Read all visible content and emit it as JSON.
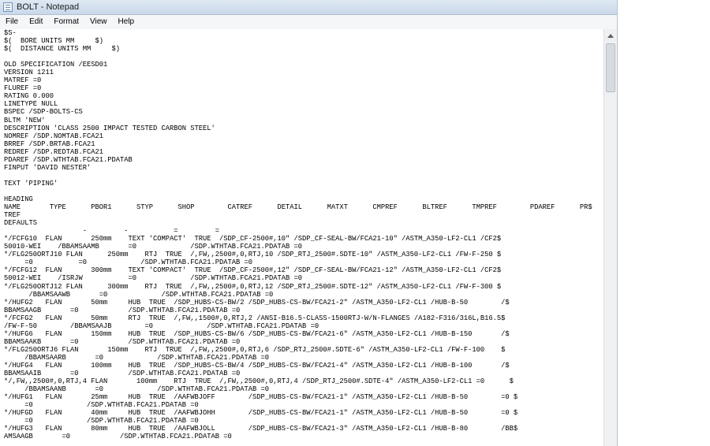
{
  "window": {
    "title": "BOLT - Notepad"
  },
  "menu": [
    "File",
    "Edit",
    "Format",
    "View",
    "Help"
  ],
  "document": {
    "lines": [
      "$S-",
      "$(  BORE UNITS MM     $)",
      "$(  DISTANCE UNITS MM     $)",
      "",
      "OLD SPECIFICATION /EESD01",
      "VERSION 1211",
      "MATREF =0",
      "FLUREF =0",
      "RATING 0.000",
      "LINETYPE NULL",
      "BSPEC /SDP-BOLTS-CS",
      "BLTM 'NEW'",
      "DESCRIPTION 'CLASS 2500 IMPACT TESTED CARBON STEEL'",
      "NOMREF /SDP.NOMTAB.FCA21",
      "BRREF /SDP.BRTAB.FCA21",
      "REDREF /SDP.REDTAB.FCA21",
      "PDAREF /SDP.WTHTAB.FCA21.PDATAB",
      "FINPUT 'DAVID NESTER'",
      "",
      "TEXT 'PIPING'",
      "",
      "HEADING",
      "NAME       TYPE      PBOR1      STYP      SHOP        CATREF      DETAIL      MATXT      CMPREF      BLTREF      TMPREF        PDAREF      PR$",
      "TREF",
      "DEFAULTS",
      "                   -         -           =         =",
      "*/FCFG10  FLAN       250mm    TEXT 'COMPACT'  TRUE  /SDP_CF-2500#,10\" /SDP_CF-SEAL-BW/FCA21-10\" /ASTM_A350-LF2-CL1 /CF2$",
      "50010-WEI    /BBAMSAAMB       =0             /SDP.WTHTAB.FCA21.PDATAB =0",
      "*/FLG250ORTJ10 FLAN      250mm    RTJ  TRUE  /,FW,,2500#,0,RTJ,10 /SDP_RTJ_2500#.SDTE-10\" /ASTM_A350-LF2-CL1 /FW-F-250 $",
      "     =0           =0             /SDP.WTHTAB.FCA21.PDATAB =0",
      "*/FCFG12  FLAN       300mm    TEXT 'COMPACT'  TRUE  /SDP_CF-2500#,12\" /SDP_CF-SEAL-BW/FCA21-12\" /ASTM_A350-LF2-CL1 /CF2$",
      "50012-WEI    /ISRJW           =0             /SDP.WTHTAB.FCA21.PDATAB =0",
      "*/FLG250ORTJ12 FLAN      300mm    RTJ  TRUE  /,FW,,2500#,0,RTJ,12 /SDP_RTJ_2500#.SDTE-12\" /ASTM_A350-LF2-CL1 /FW-F-300 $",
      "      /BBAMSAAWB       =0             /SDP.WTHTAB.FCA21.PDATAB =0",
      "*/HUFG2   FLAN       50mm     HUB  TRUE  /SDP_HUBS-CS-BW/2 /SDP_HUBS-CS-BW/FCA21-2\" /ASTM_A350-LF2-CL1 /HUB-B-50        /$",
      "BBAMSAAGB       =0            /SDP.WTHTAB.FCA21.PDATAB =0",
      "*/FCFG2   FLAN       50mm     RTJ  TRUE  /,FW,,1500#,0,RTJ,2 /ANSI-B16.5-CLASS-1500RTJ-W/N-FLANGES /A182-F316/316L,B16.5$",
      "/FW-F-50        /BBAMSAAJB        =0             /SDP.WTHTAB.FCA21.PDATAB =0",
      "*/HUFG6   FLAN       150mm    HUB  TRUE  /SDP_HUBS-CS-BW/6 /SDP_HUBS-CS-BW/FCA21-6\" /ASTM_A350-LF2-CL1 /HUB-B-150       /$",
      "BBAMSAAKB       =0            /SDP.WTHTAB.FCA21.PDATAB =0",
      "*/FLG250ORTJ6 FLAN       150mm    RTJ  TRUE  /,FW,,2500#,0,RTJ,6 /SDP_RTJ_2500#.SDTE-6\" /ASTM_A350-LF2-CL1 /FW-F-100    $",
      "     /BBAMSAARB       =0             /SDP.WTHTAB.FCA21.PDATAB =0",
      "*/HUFG4   FLAN       100mm    HUB  TRUE  /SDP_HUBS-CS-BW/4 /SDP_HUBS-CS-BW/FCA21-4\" /ASTM_A350-LF2-CL1 /HUB-B-100       /$",
      "BBAMSAAIB       =0            /SDP.WTHTAB.FCA21.PDATAB =0",
      "*/,FW,,2500#,0,RTJ,4 FLAN       100mm    RTJ  TRUE  /,FW,,2500#,0,RTJ,4 /SDP_RTJ_2500#.SDTE-4\" /ASTM_A350-LF2-CL1 =0      $",
      "     /BBAMSAANB       =0             /SDP.WTHTAB.FCA21.PDATAB =0",
      "*/HUFG1   FLAN       25mm     HUB  TRUE  /AAFWBJOFF        /SDP_HUBS-CS-BW/FCA21-1\" /ASTM_A350-LF2-CL1 /HUB-B-50        =0 $",
      "     =0             /SDP.WTHTAB.FCA21.PDATAB =0",
      "*/HUFGD   FLAN       40mm     HUB  TRUE  /AAFWBJOHH        /SDP_HUBS-CS-BW/FCA21-1\" /ASTM_A350-LF2-CL1 /HUB-B-50        =0 $",
      "     =0             /SDP.WTHTAB.FCA21.PDATAB =0",
      "*/HUFG3   FLAN       80mm     HUB  TRUE  /AAFWBJOLL        /SDP_HUBS-CS-BW/FCA21-3\" /ASTM_A350-LF2-CL1 /HUB-B-80        /BB$",
      "AMSAAGB       =0            /SDP.WTHTAB.FCA21.PDATAB =0"
    ]
  }
}
